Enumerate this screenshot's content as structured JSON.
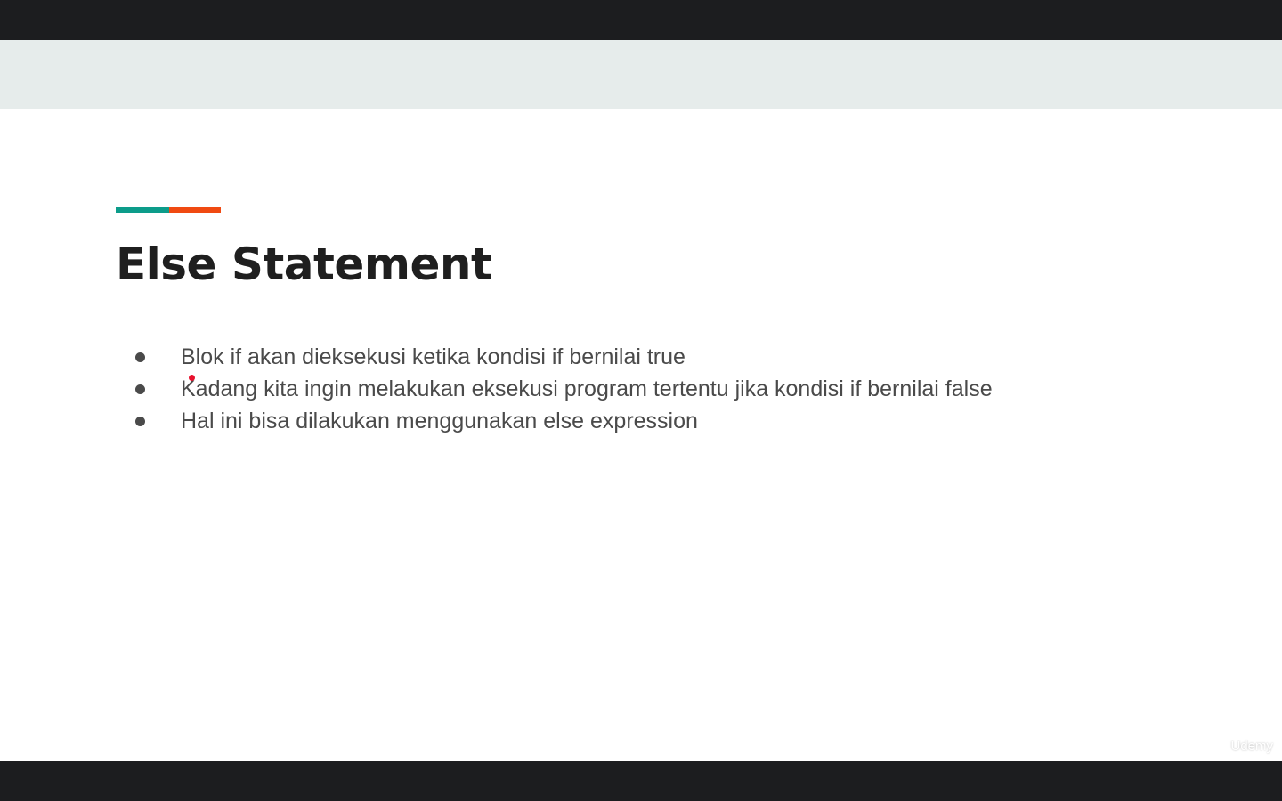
{
  "slide": {
    "title": "Else Statement",
    "bullets": [
      "Blok if akan dieksekusi ketika kondisi if bernilai true",
      "Kadang kita ingin melakukan eksekusi program tertentu jika kondisi if bernilai false",
      "Hal ini bisa dilakukan menggunakan else expression"
    ],
    "watermark": "Udemy"
  },
  "colors": {
    "accent_teal": "#0c9c8a",
    "accent_orange": "#f04a12",
    "cursor": "#e8112d"
  },
  "icons": {
    "cursor": "laser-pointer-dot"
  }
}
